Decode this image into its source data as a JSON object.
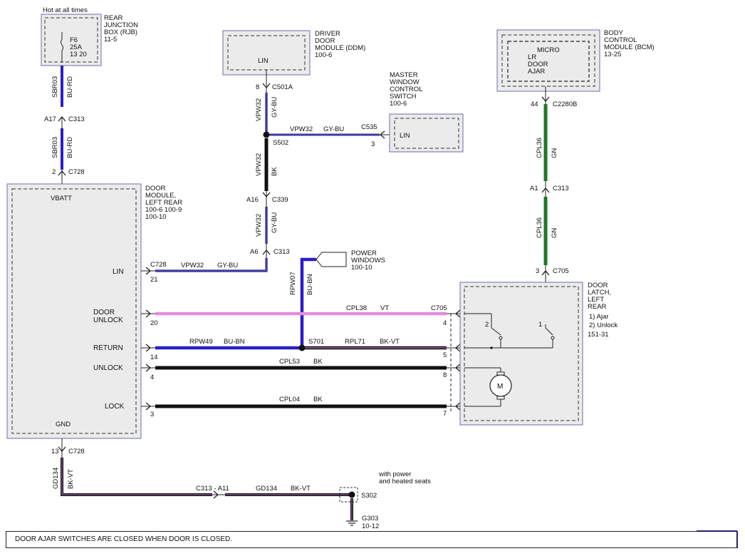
{
  "rjb": {
    "hot_label": "Hot at all times",
    "name": [
      "REAR",
      "JUNCTION",
      "BOX (RJB)",
      "11-5"
    ],
    "fuse": [
      "F6",
      "25A",
      "13 20"
    ]
  },
  "ddm": {
    "pin": "LIN",
    "name": [
      "DRIVER",
      "DOOR",
      "MODULE (DDM)",
      "100-6"
    ]
  },
  "mwcs": {
    "pin": "LIN",
    "name": [
      "MASTER",
      "WINDOW",
      "CONTROL",
      "SWITCH",
      "100-6"
    ]
  },
  "bcm": {
    "micro": "MICRO",
    "inner": [
      "LR",
      "DOOR",
      "AJAR"
    ],
    "name": [
      "BODY",
      "CONTROL",
      "MODULE (BCM)",
      "13-25"
    ]
  },
  "door_module": {
    "name": [
      "DOOR",
      "MODULE,",
      "LEFT REAR",
      "100-6  100-9",
      "100-10"
    ],
    "vbatt": "VBATT",
    "gnd": "GND",
    "pins": [
      "LIN",
      "DOOR",
      "UNLOCK",
      "RETURN",
      "UNLOCK",
      "LOCK"
    ]
  },
  "latch": {
    "name": [
      "DOOR",
      "LATCH,",
      "LEFT",
      "REAR"
    ],
    "items": [
      "1) Ajar",
      "2) Unlock",
      "151-31"
    ],
    "sw2": "2",
    "sw1": "1",
    "motor": "M"
  },
  "power_windows": [
    "POWER",
    "WINDOWS",
    "100-10"
  ],
  "seats_note": [
    "with power",
    "and heated seats"
  ],
  "wires": {
    "sbr03": "SBR03",
    "bu_rd": "BU-RD",
    "vpw32": "VPW32",
    "gy_bu": "GY-BU",
    "bk": "BK",
    "cpl36": "CPL36",
    "gn": "GN",
    "rpw07": "RPW07",
    "bu_bn": "BU-BN",
    "cpl38": "CPL38",
    "vt": "VT",
    "rpw49": "RPW49",
    "rpl71": "RPL71",
    "bk_vt": "BK-VT",
    "cpl53": "CPL53",
    "cpl04": "CPL04",
    "gd134": "GD134"
  },
  "connectors": {
    "c313": "C313",
    "c728": "C728",
    "c501a": "C501A",
    "s502": "S502",
    "c535": "C535",
    "c339": "C339",
    "c2280b": "C2280B",
    "c705": "C705",
    "s701": "S701",
    "c313_a11": "C313 - A11",
    "s302": "S302",
    "g303": "G303",
    "g303_ref": "10-12"
  },
  "pins": {
    "a17": "A17",
    "p2": "2",
    "p8": "8",
    "p3": "3",
    "a16": "A16",
    "a6": "A6",
    "p44": "44",
    "a1": "A1",
    "p3b": "3",
    "p21": "21",
    "p20": "20",
    "p14": "14",
    "p4": "4",
    "p3c": "3",
    "p13": "13",
    "r4": "4",
    "r5": "5",
    "r8": "8",
    "r7": "7"
  },
  "footer": "DOOR AJAR SWITCHES ARE CLOSED WHEN DOOR IS CLOSED."
}
